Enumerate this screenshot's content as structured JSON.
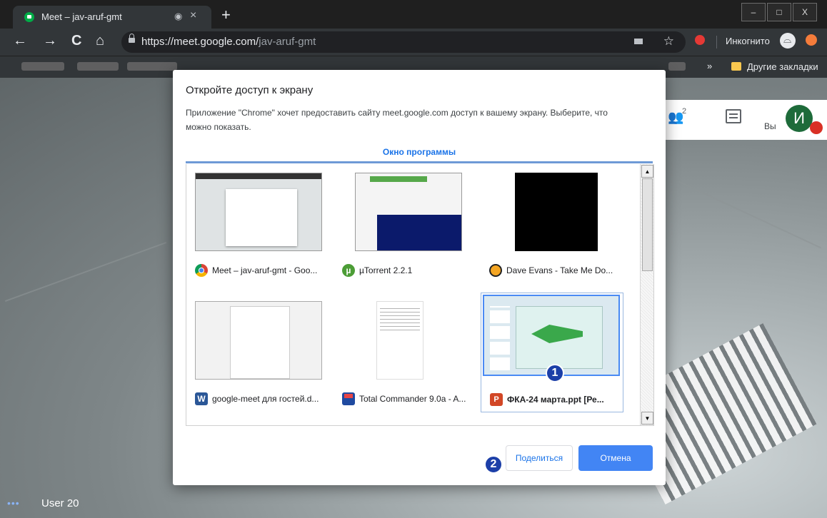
{
  "browser": {
    "tab_title": "Meet – jav-aruf-gmt",
    "tab_audio_icon": "◉",
    "tab_close_icon": "×",
    "new_tab_icon": "+",
    "window_controls": [
      "–",
      "□",
      "X"
    ],
    "nav": {
      "back": "←",
      "forward": "→",
      "reload": "C",
      "home": "⌂"
    },
    "url_host": "https://meet.google.com/",
    "url_path": "jav-aruf-gmt",
    "star_icon": "☆",
    "incognito_label": "Инкогнито",
    "bookmarks_more": "»",
    "other_bookmarks": "Другие закладки"
  },
  "meet": {
    "participants_count": "2",
    "you_label": "Вы",
    "avatar_letter": "И",
    "user_dots": "•••",
    "user_name": "User 20"
  },
  "dialog": {
    "title": "Откройте доступ к экрану",
    "description": "Приложение \"Chrome\" хочет предоставить сайту meet.google.com доступ к вашему экрану. Выберите, что можно показать.",
    "tab_label": "Окно программы",
    "scroll_up": "▲",
    "scroll_down": "▼",
    "windows": [
      {
        "label": "Meet – jav-aruf-gmt - Goo...",
        "icon": "chrome-icon",
        "selected": false
      },
      {
        "label": "µTorrent 2.2.1",
        "icon": "utorrent-icon",
        "icon_glyph": "µ",
        "selected": false
      },
      {
        "label": "Dave Evans - Take Me Do...",
        "icon": "vlc-icon",
        "selected": false
      },
      {
        "label": "google-meet для гостей.d...",
        "icon": "word-icon",
        "icon_glyph": "W",
        "selected": false
      },
      {
        "label": "Total Commander 9.0a - A...",
        "icon": "total-commander-icon",
        "selected": false
      },
      {
        "label": "ФКА-24 марта.ppt [Ре...",
        "icon": "powerpoint-icon",
        "icon_glyph": "P",
        "selected": true
      }
    ],
    "badge_1": "1",
    "badge_2": "2",
    "share_button": "Поделиться",
    "cancel_button": "Отмена"
  },
  "colors": {
    "accent": "#1a73e8",
    "cancel_bg": "#4285f4",
    "badge_bg": "#1c3fa8",
    "chrome_dark": "#323639"
  }
}
